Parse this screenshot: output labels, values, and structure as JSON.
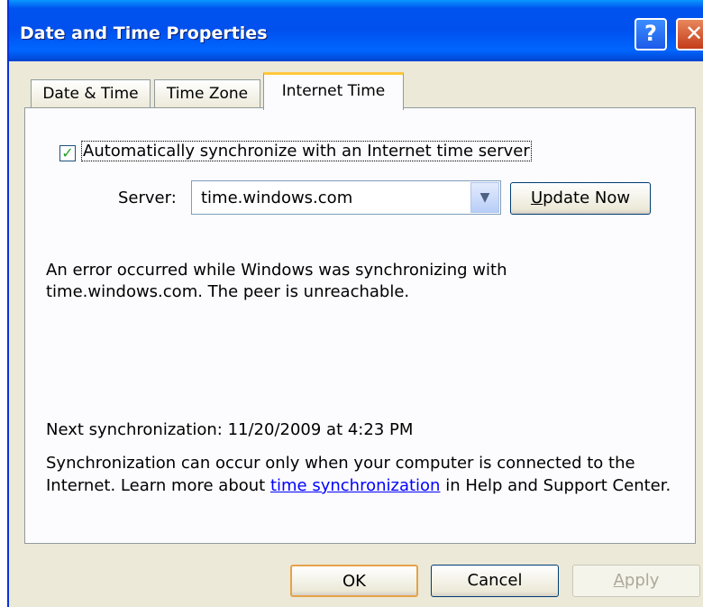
{
  "window": {
    "title": "Date and Time Properties",
    "help_glyph": "?",
    "close_glyph": "✕"
  },
  "tabs": [
    {
      "label": "Date & Time"
    },
    {
      "label": "Time Zone"
    },
    {
      "label": "Internet Time",
      "active": true
    }
  ],
  "internet_time": {
    "auto_sync_label": "Automatically synchronize with an Internet time server",
    "auto_sync_checked": true,
    "server_label": "Server:",
    "server_value": "time.windows.com",
    "update_now_label_prefix": "U",
    "update_now_label_rest": "pdate Now",
    "error_message": "An error occurred while Windows was synchronizing with time.windows.com.  The peer is unreachable.",
    "next_sync": "Next synchronization: 11/20/2009 at 4:23 PM",
    "info_before_link": "Synchronization can occur only when your computer is connected to the Internet.  Learn more about ",
    "info_link": "time synchronization",
    "info_after_link": " in Help and Support Center."
  },
  "buttons": {
    "ok": "OK",
    "cancel": "Cancel",
    "apply_prefix": "A",
    "apply_rest": "pply"
  },
  "colors": {
    "titlebar": "#0053ee",
    "active_tab_accent": "#ffc83c",
    "checkmark": "#21a121"
  },
  "icons": {
    "check": "checkmark-icon",
    "dropdown": "chevron-down-icon",
    "help": "help-icon",
    "close": "close-icon"
  }
}
